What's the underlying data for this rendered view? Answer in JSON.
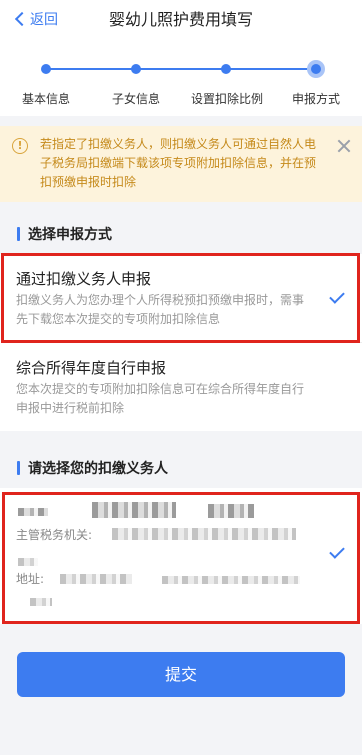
{
  "nav": {
    "back_label": "返回",
    "title": "婴幼儿照护费用填写"
  },
  "steps": [
    {
      "label": "基本信息"
    },
    {
      "label": "子女信息"
    },
    {
      "label": "设置扣除比例"
    },
    {
      "label": "申报方式"
    }
  ],
  "notice": {
    "text": "若指定了扣缴义务人，则扣缴义务人可通过自然人电子税务局扣缴端下载该项专项附加扣除信息，并在预扣预缴申报时扣除"
  },
  "section_method": {
    "title": "选择申报方式"
  },
  "options": [
    {
      "title": "通过扣缴义务人申报",
      "desc": "扣缴义务人为您办理个人所得税预扣预缴申报时，需事先下载您本次提交的专项附加扣除信息",
      "selected": true
    },
    {
      "title": "综合所得年度自行申报",
      "desc": "您本次提交的专项附加扣除信息可在综合所得年度自行申报中进行税前扣除",
      "selected": false
    }
  ],
  "section_payer": {
    "title": "请选择您的扣缴义务人"
  },
  "payer": {
    "tax_authority_label": "主管税务机关:",
    "address_label": "地址:",
    "selected": true
  },
  "submit_label": "提交",
  "colors": {
    "accent": "#3d7cf0",
    "notice_bg": "#fdf3dc",
    "notice_text": "#c58a1b",
    "highlight": "#e0241d"
  }
}
